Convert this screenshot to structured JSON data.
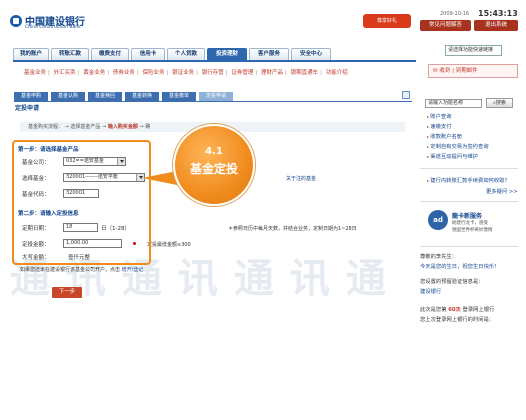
{
  "header": {
    "bank_cn": "中国建设银行",
    "bank_en": "China Construction Bank",
    "gift_label": "尊享好礼",
    "date": "2009-10-16",
    "time": "15:43:13",
    "faq": "常见问题解答",
    "logout": "退出系统"
  },
  "nav": {
    "tabs": [
      "我的账户",
      "转账汇款",
      "缴费支付",
      "信用卡",
      "个人贷款",
      "投资理财",
      "客户服务",
      "安全中心"
    ],
    "active_index": 5,
    "select_label": "请选择功能快速链接"
  },
  "subnav": {
    "items": [
      "基金业务",
      "外汇买卖",
      "黄金业务",
      "债券业务",
      "保险业务",
      "银证业务",
      "银行存管",
      "证券管理",
      "理财产品",
      "银期直通车",
      "功能介绍"
    ]
  },
  "mailbox": {
    "label": "收到",
    "link": "到期邮件"
  },
  "content_tabs": {
    "items": [
      "基金申购",
      "基金认购",
      "基金赎回",
      "基金转换",
      "基金撤单",
      "定投申请"
    ],
    "active_index": 5
  },
  "page_title": "定投申请",
  "steps": {
    "prefix": "基金购买流程：",
    "step1": "选择基金产品",
    "current": "输入购买金额",
    "step3": "确"
  },
  "form": {
    "step1_title": "第一步：请选择基金产品",
    "company_label": "基金公司：",
    "company_value": "032==诺安基金",
    "fund_label": "选择基金：",
    "fund_value": "320001-------诺安平衡",
    "code_label": "基金代码：",
    "code_value": "320001",
    "step2_title": "第二步：请输入定投信息",
    "date_label": "定期日期：",
    "date_value": "18",
    "date_unit": "日（1-28）",
    "amount_label": "定投金额：",
    "amount_value": "1,000.00",
    "capital_label": "大写金额：",
    "capital_value": "壹仟元整",
    "follow_link": "关于注的基金",
    "note_date": "＊参照日历中每月天数，并结合业务，定制日期为1~28日",
    "note_amount": "定投最低金额≥300",
    "footer_note": "如果您还未在建设银行该基金公司开户，点击",
    "footer_link": "增开/登记"
  },
  "callout": {
    "number": "4.1",
    "text": "基金定投"
  },
  "next_button": "下一步",
  "watermark": [
    "通",
    "讯",
    "通",
    "讯",
    "通",
    "讯",
    "通"
  ],
  "right": {
    "search_placeholder": "请输入功能名称",
    "search_button": "搜索",
    "links": [
      "账户查询",
      "速缴支付",
      "收款账户名册",
      "定制自有交易为签约查询",
      "渠道互动提问与维护"
    ],
    "promo_link": "建行内转账汇款手续费如何收取？",
    "more": "更多疑问 >>",
    "promo_title": "龍卡新服务",
    "promo_sub1": "刷建行龙卡，感受",
    "promo_sub2": "德国世界杯奇妙激情",
    "greeting1": "尊敬的李先生：",
    "greeting2": "今天是您的生日，祝您生日快乐！",
    "cert_label": "您设置的预留验证信息是：",
    "cert_value": "建设银行",
    "login_info1": "此次是您第",
    "login_count": "60次",
    "login_info2": "登录网上银行",
    "login_info3": "您上次登录网上银行的时间是："
  }
}
